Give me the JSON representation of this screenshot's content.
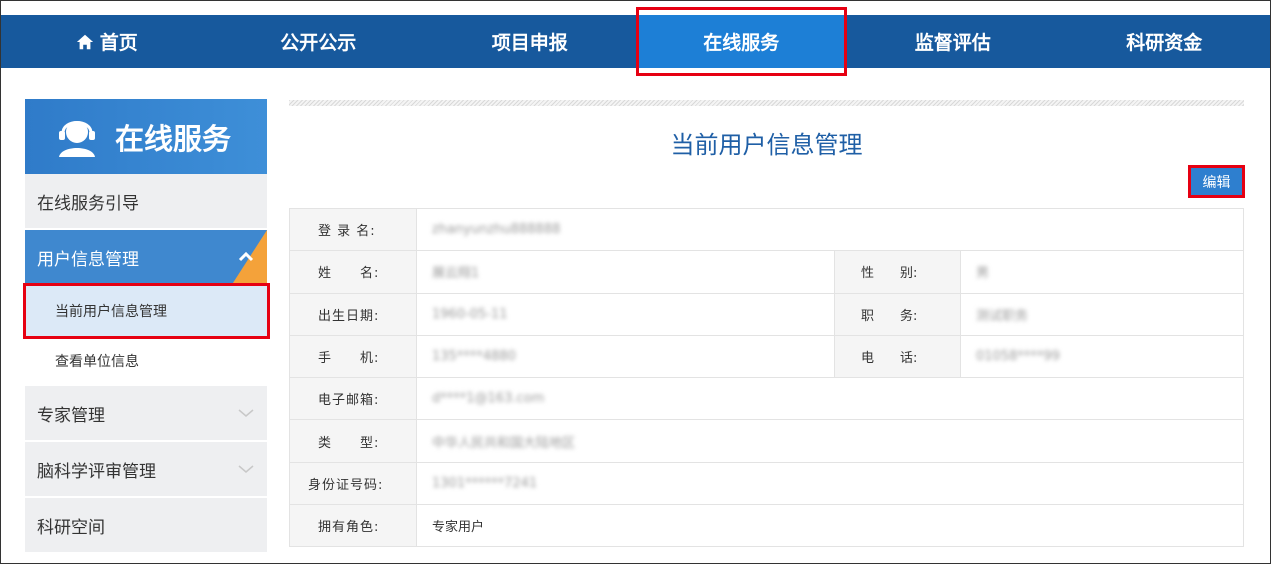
{
  "nav": {
    "items": [
      "首页",
      "公开公示",
      "项目申报",
      "在线服务",
      "监督评估",
      "科研资金"
    ],
    "active": "在线服务"
  },
  "sidebar": {
    "header": "在线服务",
    "items": [
      {
        "label": "在线服务引导"
      },
      {
        "label": "用户信息管理",
        "expanded": true,
        "children": [
          "当前用户信息管理",
          "查看单位信息"
        ]
      },
      {
        "label": "专家管理"
      },
      {
        "label": "脑科学评审管理"
      },
      {
        "label": "科研空间"
      }
    ],
    "active_child": "当前用户信息管理"
  },
  "main": {
    "title": "当前用户信息管理",
    "edit_label": "编辑",
    "fields": {
      "login_label": "登 录 名:",
      "login_value": "zhanyunzhu888888",
      "name_label": "姓　　名:",
      "name_value": "展云翔1",
      "gender_label": "性　　别:",
      "gender_value": "男",
      "birth_label": "出生日期:",
      "birth_value": "1960-05-11",
      "title_label": "职　　务:",
      "title_value": "测试职务",
      "mobile_label": "手　　机:",
      "mobile_value": "135****4880",
      "phone_label": "电　　话:",
      "phone_value": "01058****99",
      "email_label": "电子邮箱:",
      "email_value": "d****1@163.com",
      "type_label": "类　　型:",
      "type_value": "中华人民共和国大陆地区",
      "id_label": "身份证号码:",
      "id_value": "1301******7241",
      "role_label": "拥有角色:",
      "role_value": "专家用户"
    }
  },
  "colors": {
    "nav_bg": "#17599d",
    "nav_active": "#1d7fd6",
    "highlight": "#e60012",
    "accent": "#f4a23a"
  }
}
